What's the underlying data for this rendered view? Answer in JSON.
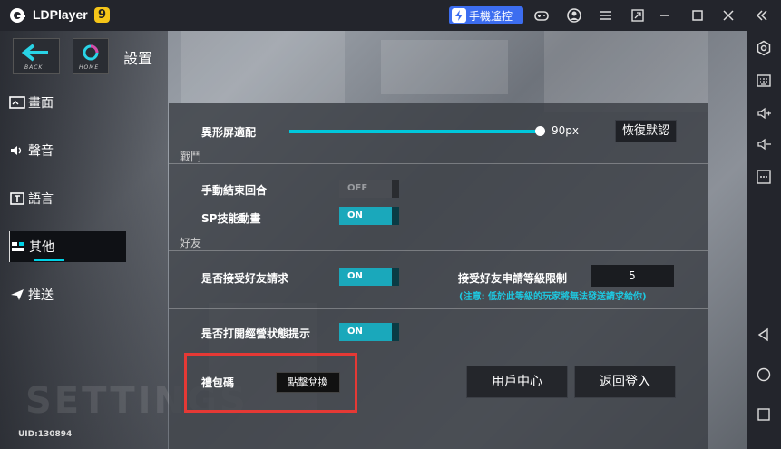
{
  "titlebar": {
    "app_name": "LDPlayer",
    "app_version_badge": "9",
    "remote_control_label": "手機遙控"
  },
  "header": {
    "back_label": "BACK",
    "home_label": "HOME",
    "page_title": "設置"
  },
  "sidebar": {
    "items": [
      {
        "label": "畫面",
        "icon": "display-icon"
      },
      {
        "label": "聲音",
        "icon": "speaker-icon"
      },
      {
        "label": "語言",
        "icon": "language-icon"
      },
      {
        "label": "其他",
        "icon": "other-icon",
        "active": true
      },
      {
        "label": "推送",
        "icon": "push-icon"
      }
    ],
    "uid": "UID:130894"
  },
  "watermark": "SETTINGS",
  "display": {
    "notch_label": "異形屏適配",
    "notch_value": "90px",
    "notch_level": 1.0,
    "reset_label": "恢復默認"
  },
  "battle": {
    "section_title": "戰鬥",
    "auto_end_label": "手動結束回合",
    "auto_end_state": "OFF",
    "sp_anim_label": "SP技能動畫",
    "sp_anim_state": "ON"
  },
  "friends": {
    "section_title": "好友",
    "accept_label": "是否接受好友請求",
    "accept_state": "ON",
    "level_limit_label": "接受好友申請等級限制",
    "level_limit_value": "5",
    "note": "(注意: 低於此等級的玩家將無法發送請求給你)",
    "business_tip_label": "是否打開經營狀態提示",
    "business_tip_state": "ON"
  },
  "gift": {
    "label": "禮包碼",
    "redeem_label": "點擊兌換"
  },
  "actions": {
    "user_center_label": "用戶中心",
    "back_login_label": "返回登入"
  },
  "colors": {
    "accent": "#00c8dc",
    "toggle_on": "#1aa8bb",
    "highlight": "#e53935",
    "remote_btn": "#3c6df0"
  }
}
